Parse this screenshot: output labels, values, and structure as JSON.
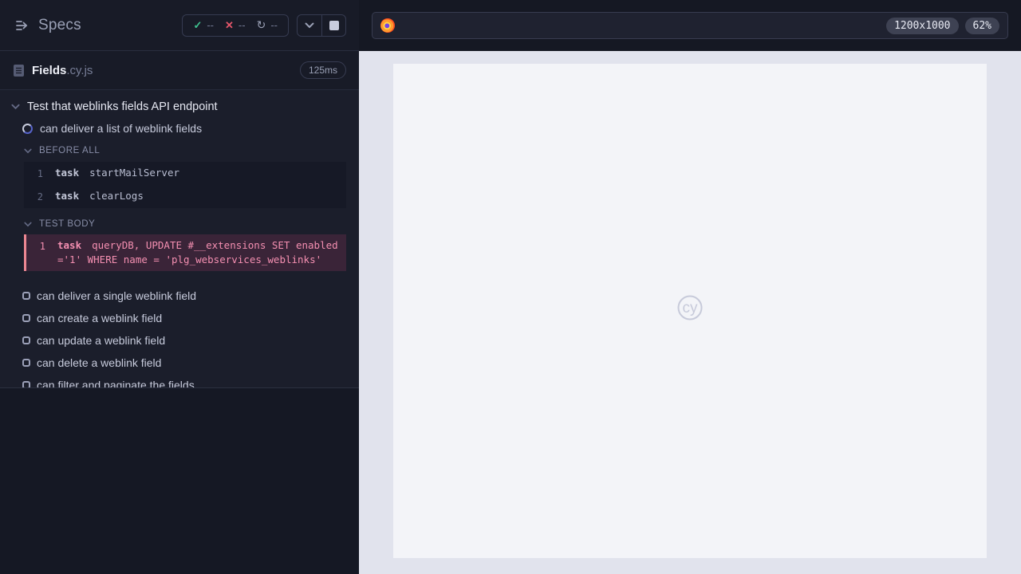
{
  "sidebar": {
    "title": "Specs",
    "stats": {
      "passed": "--",
      "failed": "--",
      "pending": "--"
    },
    "controls": {
      "collapse": "chevron-down",
      "stop": "stop"
    },
    "spec_file": {
      "name": "Fields",
      "ext": ".cy.js",
      "duration": "125ms"
    },
    "suite": {
      "title": "Test that weblinks fields API endpoint",
      "running_test": "can deliver a list of weblink fields",
      "hooks": [
        {
          "label": "BEFORE ALL",
          "commands": [
            {
              "n": "1",
              "method": "task",
              "message": "startMailServer"
            },
            {
              "n": "2",
              "method": "task",
              "message": "clearLogs"
            }
          ]
        },
        {
          "label": "TEST BODY",
          "commands": [
            {
              "n": "1",
              "method": "task",
              "message": "queryDB, UPDATE #__extensions SET enabled ='1' WHERE name = 'plg_webservices_weblinks'"
            }
          ]
        }
      ],
      "pending_tests": [
        "can deliver a single weblink field",
        "can create a weblink field",
        "can update a weblink field",
        "can delete a weblink field",
        "can filter and paginate the fields"
      ]
    }
  },
  "viewport": {
    "url": "",
    "dimensions": "1200x1000",
    "scale": "62%",
    "watermark": "cy"
  },
  "colors": {
    "passed_green": "#3fc490",
    "failed_red": "#e4566a",
    "running_indigo": "#5663c9",
    "highlight_pink": "#f48fb1",
    "highlight_border": "#ec8792",
    "highlight_bg": "#3a2438"
  }
}
